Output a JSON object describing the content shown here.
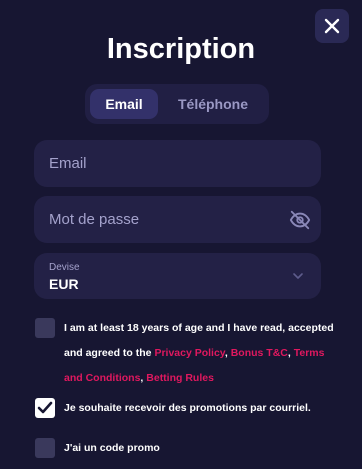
{
  "modal": {
    "title": "Inscription",
    "close_icon": "close-icon"
  },
  "tabs": [
    {
      "label": "Email",
      "active": true
    },
    {
      "label": "Téléphone",
      "active": false
    }
  ],
  "form": {
    "email_placeholder": "Email",
    "password_placeholder": "Mot de passe",
    "password_toggle_icon": "eye-off-icon",
    "currency": {
      "label": "Devise",
      "value": "EUR",
      "icon": "chevron-down-icon"
    }
  },
  "consents": {
    "terms": {
      "checked": false,
      "text_before": "I am at least 18 years of age and I have read, accepted and agreed to the ",
      "link_privacy": "Privacy Policy",
      "sep1": ", ",
      "link_bonus": "Bonus T&C",
      "sep2": ", ",
      "link_terms": "Terms and Conditions",
      "sep3": ", ",
      "link_betting": "Betting Rules"
    },
    "promotions": {
      "checked": true,
      "text": "Je souhaite recevoir des promotions par courriel."
    },
    "promo_code": {
      "checked": false,
      "text": "J'ai un code promo"
    }
  },
  "colors": {
    "background": "#171632",
    "field_background": "#232146",
    "link": "#e0185f",
    "tab_active": "#33316a"
  }
}
